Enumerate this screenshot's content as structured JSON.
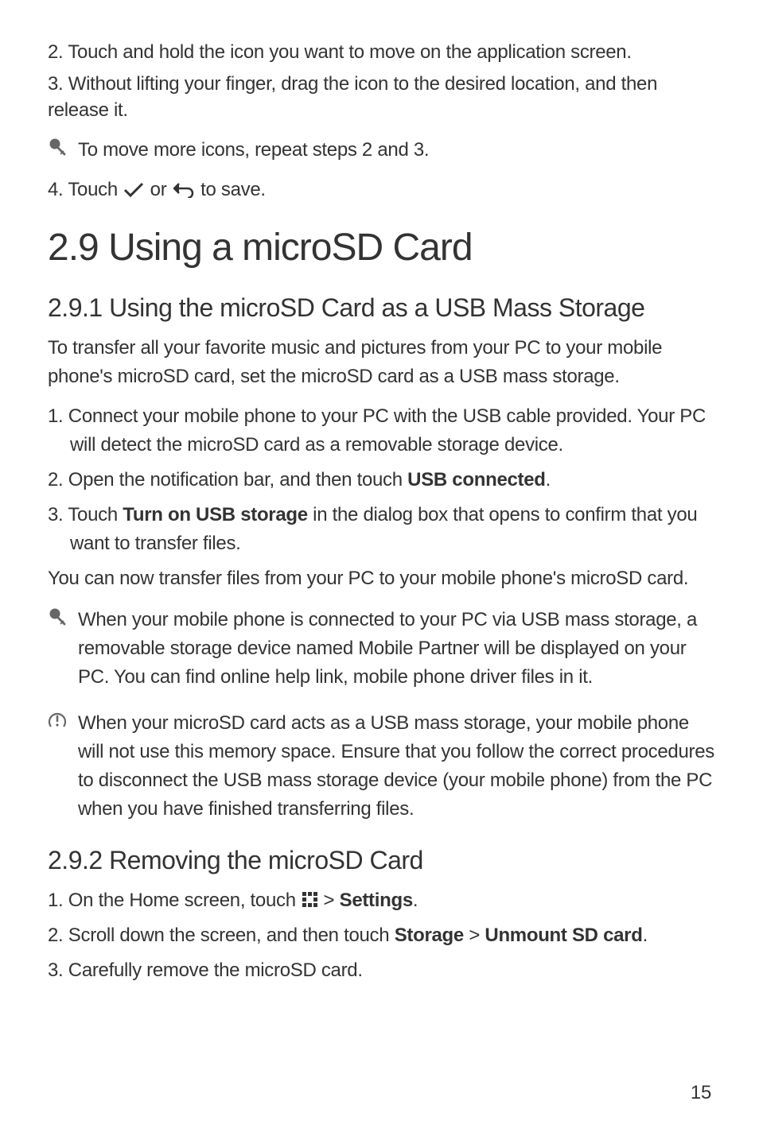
{
  "step2": "2. Touch and hold the icon you want to move on the application screen.",
  "step3": "3. Without lifting your finger, drag the icon to the desired location, and then release it.",
  "note_repeat": "To move more icons, repeat steps 2 and 3.",
  "step4_a": "4. Touch ",
  "step4_b": " or ",
  "step4_c": " to save.",
  "h1": "2.9  Using a microSD Card",
  "h2_1": "2.9.1  Using the microSD Card as a USB Mass Storage",
  "para_intro": "To transfer all your favorite music and pictures from your PC to your mobile phone's microSD card, set the microSD card as a USB mass storage.",
  "li1": "1. Connect your mobile phone to your PC with the USB cable provided. Your PC will detect the microSD card as a removable storage device.",
  "li2_a": "2. Open the notification bar, and then touch ",
  "li2_b": "USB connected",
  "li2_c": ".",
  "li3_a": "3. Touch ",
  "li3_b": "Turn on USB storage",
  "li3_c": " in the dialog box that opens to confirm that you want to transfer files.",
  "para_now": "You can now transfer files from your PC to your mobile phone's microSD card.",
  "note_partner": "When your mobile phone is connected to your PC via USB mass storage, a removable storage device named Mobile Partner will be displayed on your PC. You can find online help link, mobile phone driver files in it.",
  "caution_text": "When your microSD card acts as a USB mass storage, your mobile phone will not use this memory space. Ensure that you follow the correct procedures to disconnect the USB mass storage device (your mobile phone) from the PC when you have finished transferring files.",
  "h2_2": "2.9.2  Removing the microSD Card",
  "r_li1_a": "1. On the Home screen, touch ",
  "r_li1_b": " > ",
  "r_li1_c": "Settings",
  "r_li1_d": ".",
  "r_li2_a": "2. Scroll down the screen, and then touch ",
  "r_li2_b": "Storage",
  "r_li2_c": " > ",
  "r_li2_d": "Unmount SD card",
  "r_li2_e": ".",
  "r_li3": "3. Carefully remove the microSD card.",
  "page_number": "15"
}
